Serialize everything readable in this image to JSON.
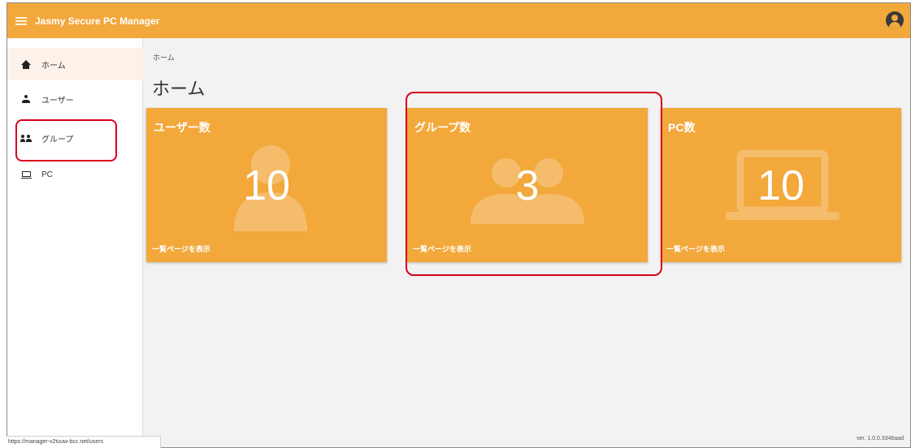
{
  "app": {
    "title": "Jasmy Secure PC Manager"
  },
  "sidebar": {
    "items": [
      {
        "label": "ホーム",
        "icon": "home-icon"
      },
      {
        "label": "ユーザー",
        "icon": "person-icon"
      },
      {
        "label": "グループ",
        "icon": "group-icon"
      },
      {
        "label": "PC",
        "icon": "laptop-icon"
      }
    ]
  },
  "main": {
    "breadcrumb": "ホーム",
    "title": "ホーム",
    "cards": [
      {
        "title": "ユーザー数",
        "value": "10",
        "link": "一覧ページを表示",
        "icon": "person-icon"
      },
      {
        "title": "グループ数",
        "value": "3",
        "link": "一覧ページを表示",
        "icon": "group-icon"
      },
      {
        "title": "PC数",
        "value": "10",
        "link": "一覧ページを表示",
        "icon": "laptop-icon"
      }
    ]
  },
  "statusbar": {
    "url": "https://manager-v2tuuw-bcc.net/users"
  },
  "footer": {
    "version": "ver. 1.0.0.3346aad"
  },
  "colors": {
    "accent": "#f2a83b",
    "highlight": "#d9001b"
  }
}
